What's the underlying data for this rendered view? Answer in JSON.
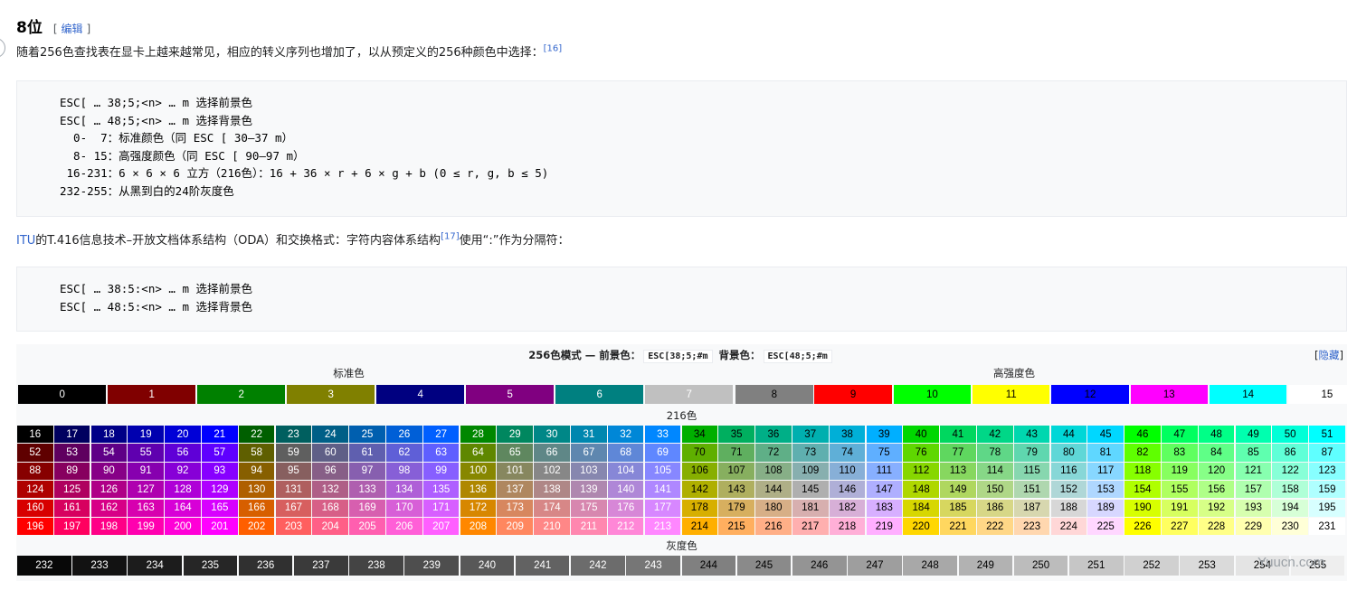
{
  "section": {
    "title": "8位",
    "edit_open": "[",
    "edit_label": "编辑",
    "edit_close": "]"
  },
  "intro": {
    "text": "随着256色查找表在显卡上越来越常见，相应的转义序列也增加了，以从预定义的256种颜色中选择：",
    "ref": "[16]"
  },
  "code1": {
    "lines": [
      "ESC[ … 38;5;<n> … m 选择前景色",
      "ESC[ … 48;5;<n> … m 选择背景色",
      "  0-  7：标准颜色（同 ESC [ 30–37 m）",
      "  8- 15：高强度颜色（同 ESC [ 90–97 m）",
      " 16-231：6 × 6 × 6 立方（216色）：16 + 36 × r + 6 × g + b (0 ≤ r, g, b ≤ 5)",
      "232-255：从黑到白的24阶灰度色"
    ]
  },
  "itu": {
    "link": "ITU",
    "text1": "的T.416信息技术–开放文档体系结构（ODA）和交换格式：字符内容体系结构",
    "ref": "[17]",
    "text2": "使用“:”作为分隔符："
  },
  "code2": {
    "lines": [
      "ESC[ … 38:5:<n> … m 选择前景色",
      "ESC[ … 48:5:<n> … m 选择背景色"
    ]
  },
  "color_table": {
    "title_prefix": "256色模式 — 前景色：",
    "fg_code": "ESC[38;5;#m",
    "title_mid": "背景色：",
    "bg_code": "ESC[48;5;#m",
    "hide_open": "[",
    "hide_label": "隐藏",
    "hide_close": "]",
    "standard_label": "标准色",
    "high_label": "高强度色",
    "cube_label": "216色",
    "gray_label": "灰度色",
    "standard": [
      {
        "n": "0",
        "bg": "#000000",
        "fg": "#ffffff"
      },
      {
        "n": "1",
        "bg": "#800000",
        "fg": "#ffffff"
      },
      {
        "n": "2",
        "bg": "#008000",
        "fg": "#ffffff"
      },
      {
        "n": "3",
        "bg": "#808000",
        "fg": "#ffffff"
      },
      {
        "n": "4",
        "bg": "#000080",
        "fg": "#ffffff"
      },
      {
        "n": "5",
        "bg": "#800080",
        "fg": "#ffffff"
      },
      {
        "n": "6",
        "bg": "#008080",
        "fg": "#ffffff"
      },
      {
        "n": "7",
        "bg": "#c0c0c0",
        "fg": "#ffffff"
      }
    ],
    "high": [
      {
        "n": "8",
        "bg": "#808080",
        "fg": "#000000"
      },
      {
        "n": "9",
        "bg": "#ff0000",
        "fg": "#000000"
      },
      {
        "n": "10",
        "bg": "#00ff00",
        "fg": "#000000"
      },
      {
        "n": "11",
        "bg": "#ffff00",
        "fg": "#000000"
      },
      {
        "n": "12",
        "bg": "#0000ff",
        "fg": "#000000"
      },
      {
        "n": "13",
        "bg": "#ff00ff",
        "fg": "#000000"
      },
      {
        "n": "14",
        "bg": "#00ffff",
        "fg": "#000000"
      },
      {
        "n": "15",
        "bg": "#ffffff",
        "fg": "#000000"
      }
    ],
    "cube_levels": [
      "#000000",
      "#5f0000",
      "#870000",
      "#af0000",
      "#d70000",
      "#ff0000"
    ],
    "cube_rows": [
      [
        "16",
        "17",
        "18",
        "19",
        "20",
        "21",
        "22",
        "23",
        "24",
        "25",
        "26",
        "27",
        "28",
        "29",
        "30",
        "31",
        "32",
        "33",
        "34",
        "35",
        "36",
        "37",
        "38",
        "39",
        "40",
        "41",
        "42",
        "43",
        "44",
        "45",
        "46",
        "47",
        "48",
        "49",
        "50",
        "51"
      ],
      [
        "52",
        "53",
        "54",
        "55",
        "56",
        "57",
        "58",
        "59",
        "60",
        "61",
        "62",
        "63",
        "64",
        "65",
        "66",
        "67",
        "68",
        "69",
        "70",
        "71",
        "72",
        "73",
        "74",
        "75",
        "76",
        "77",
        "78",
        "79",
        "80",
        "81",
        "82",
        "83",
        "84",
        "85",
        "86",
        "87"
      ],
      [
        "88",
        "89",
        "90",
        "91",
        "92",
        "93",
        "94",
        "95",
        "96",
        "97",
        "98",
        "99",
        "100",
        "101",
        "102",
        "103",
        "104",
        "105",
        "106",
        "107",
        "108",
        "109",
        "110",
        "111",
        "112",
        "113",
        "114",
        "115",
        "116",
        "117",
        "118",
        "119",
        "120",
        "121",
        "122",
        "123"
      ],
      [
        "124",
        "125",
        "126",
        "127",
        "128",
        "129",
        "130",
        "131",
        "132",
        "133",
        "134",
        "135",
        "136",
        "137",
        "138",
        "139",
        "140",
        "141",
        "142",
        "143",
        "144",
        "145",
        "146",
        "147",
        "148",
        "149",
        "150",
        "151",
        "152",
        "153",
        "154",
        "155",
        "156",
        "157",
        "158",
        "159"
      ],
      [
        "160",
        "161",
        "162",
        "163",
        "164",
        "165",
        "166",
        "167",
        "168",
        "169",
        "170",
        "171",
        "172",
        "173",
        "174",
        "175",
        "176",
        "177",
        "178",
        "179",
        "180",
        "181",
        "182",
        "183",
        "184",
        "185",
        "186",
        "187",
        "188",
        "189",
        "190",
        "191",
        "192",
        "193",
        "194",
        "195"
      ],
      [
        "196",
        "197",
        "198",
        "199",
        "200",
        "201",
        "202",
        "203",
        "204",
        "205",
        "206",
        "207",
        "208",
        "209",
        "210",
        "211",
        "212",
        "213",
        "214",
        "215",
        "216",
        "217",
        "218",
        "219",
        "220",
        "221",
        "222",
        "223",
        "224",
        "225",
        "226",
        "227",
        "228",
        "229",
        "230",
        "231"
      ]
    ],
    "gray": [
      "232",
      "233",
      "234",
      "235",
      "236",
      "237",
      "238",
      "239",
      "240",
      "241",
      "242",
      "243",
      "244",
      "245",
      "246",
      "247",
      "248",
      "249",
      "250",
      "251",
      "252",
      "253",
      "254",
      "255"
    ]
  },
  "watermark": "Yuucn.com"
}
